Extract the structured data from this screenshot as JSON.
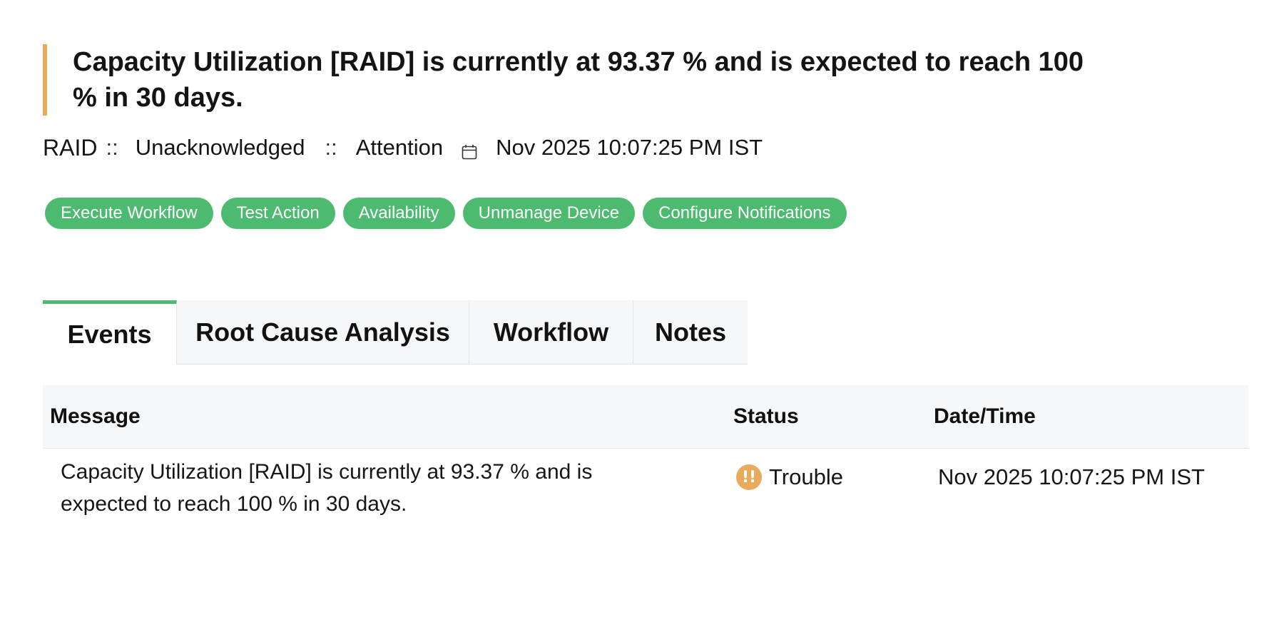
{
  "alert": {
    "headline": "Capacity Utilization [RAID] is currently at 93.37 % and is expected to reach 100 % in 30 days."
  },
  "meta": {
    "device": "RAID",
    "separator": "::",
    "ack_state": "Unacknowledged",
    "severity": "Attention",
    "calendar_icon": "calendar-icon",
    "timestamp": "Nov 2025 10:07:25 PM IST"
  },
  "actions": [
    {
      "label": "Execute Workflow"
    },
    {
      "label": "Test Action"
    },
    {
      "label": "Availability"
    },
    {
      "label": "Unmanage Device"
    },
    {
      "label": "Configure Notifications"
    }
  ],
  "tabs": [
    {
      "label": "Events",
      "active": true
    },
    {
      "label": "Root Cause Analysis",
      "active": false
    },
    {
      "label": "Workflow",
      "active": false
    },
    {
      "label": "Notes",
      "active": false
    }
  ],
  "events_table": {
    "columns": [
      "Message",
      "Status",
      "Date/Time"
    ],
    "rows": [
      {
        "message": "Capacity Utilization [RAID] is currently at 93.37 % and is expected to reach 100 % in 30 days.",
        "status": "Trouble",
        "status_icon": "!!",
        "datetime": "Nov 2025 10:07:25 PM IST"
      }
    ]
  },
  "colors": {
    "accent_green": "#4dbb6f",
    "attention_orange": "#e8ab5b"
  }
}
